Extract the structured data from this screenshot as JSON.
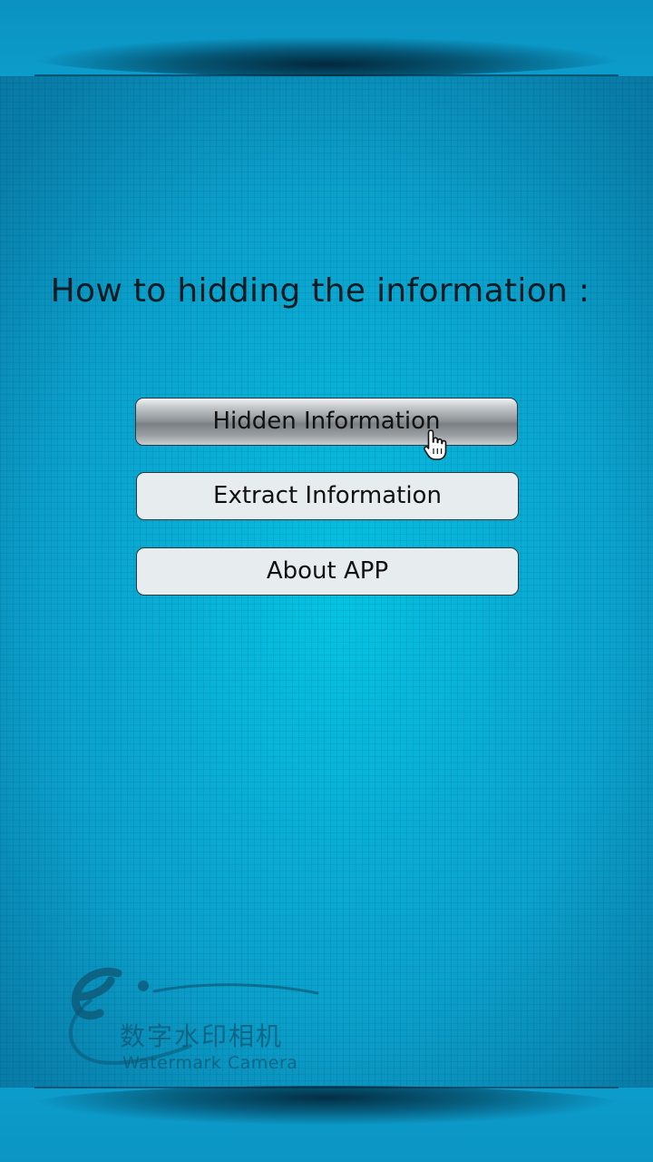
{
  "heading": "How to hidding the information :",
  "buttons": {
    "hidden": "Hidden Information",
    "extract": "Extract Information",
    "about": "About APP"
  },
  "logo": {
    "chinese": "数字水印相机",
    "english": "Watermark Camera"
  },
  "colors": {
    "background": "#0aa9d2",
    "button_face": "#e7ecee",
    "button_pressed": "#8e9498",
    "text": "#0c1a22"
  },
  "icons": {
    "cursor": "hand-pointer-icon",
    "logo_mark": "e-logo-icon"
  }
}
